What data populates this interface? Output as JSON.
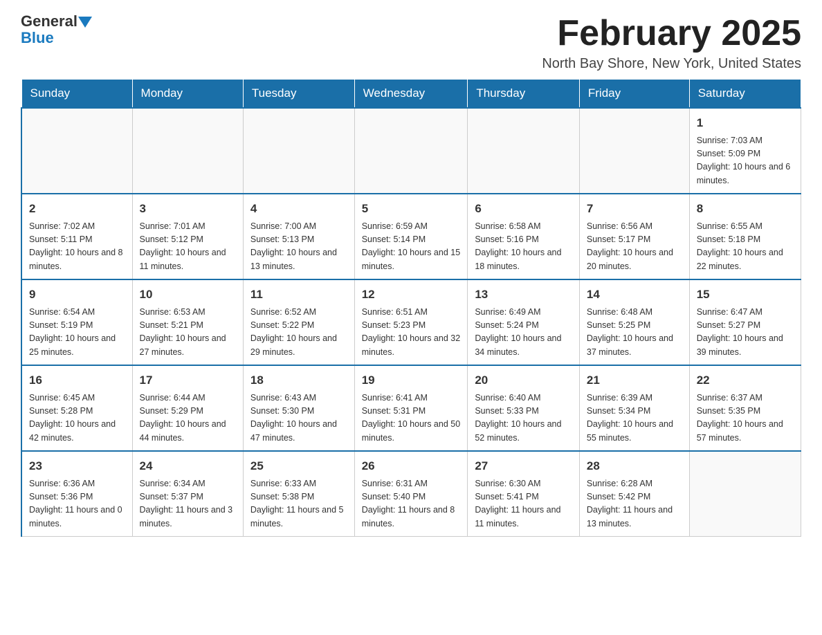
{
  "logo": {
    "general": "General",
    "blue": "Blue"
  },
  "header": {
    "title": "February 2025",
    "location": "North Bay Shore, New York, United States"
  },
  "days_of_week": [
    "Sunday",
    "Monday",
    "Tuesday",
    "Wednesday",
    "Thursday",
    "Friday",
    "Saturday"
  ],
  "weeks": [
    [
      {
        "day": "",
        "info": ""
      },
      {
        "day": "",
        "info": ""
      },
      {
        "day": "",
        "info": ""
      },
      {
        "day": "",
        "info": ""
      },
      {
        "day": "",
        "info": ""
      },
      {
        "day": "",
        "info": ""
      },
      {
        "day": "1",
        "info": "Sunrise: 7:03 AM\nSunset: 5:09 PM\nDaylight: 10 hours and 6 minutes."
      }
    ],
    [
      {
        "day": "2",
        "info": "Sunrise: 7:02 AM\nSunset: 5:11 PM\nDaylight: 10 hours and 8 minutes."
      },
      {
        "day": "3",
        "info": "Sunrise: 7:01 AM\nSunset: 5:12 PM\nDaylight: 10 hours and 11 minutes."
      },
      {
        "day": "4",
        "info": "Sunrise: 7:00 AM\nSunset: 5:13 PM\nDaylight: 10 hours and 13 minutes."
      },
      {
        "day": "5",
        "info": "Sunrise: 6:59 AM\nSunset: 5:14 PM\nDaylight: 10 hours and 15 minutes."
      },
      {
        "day": "6",
        "info": "Sunrise: 6:58 AM\nSunset: 5:16 PM\nDaylight: 10 hours and 18 minutes."
      },
      {
        "day": "7",
        "info": "Sunrise: 6:56 AM\nSunset: 5:17 PM\nDaylight: 10 hours and 20 minutes."
      },
      {
        "day": "8",
        "info": "Sunrise: 6:55 AM\nSunset: 5:18 PM\nDaylight: 10 hours and 22 minutes."
      }
    ],
    [
      {
        "day": "9",
        "info": "Sunrise: 6:54 AM\nSunset: 5:19 PM\nDaylight: 10 hours and 25 minutes."
      },
      {
        "day": "10",
        "info": "Sunrise: 6:53 AM\nSunset: 5:21 PM\nDaylight: 10 hours and 27 minutes."
      },
      {
        "day": "11",
        "info": "Sunrise: 6:52 AM\nSunset: 5:22 PM\nDaylight: 10 hours and 29 minutes."
      },
      {
        "day": "12",
        "info": "Sunrise: 6:51 AM\nSunset: 5:23 PM\nDaylight: 10 hours and 32 minutes."
      },
      {
        "day": "13",
        "info": "Sunrise: 6:49 AM\nSunset: 5:24 PM\nDaylight: 10 hours and 34 minutes."
      },
      {
        "day": "14",
        "info": "Sunrise: 6:48 AM\nSunset: 5:25 PM\nDaylight: 10 hours and 37 minutes."
      },
      {
        "day": "15",
        "info": "Sunrise: 6:47 AM\nSunset: 5:27 PM\nDaylight: 10 hours and 39 minutes."
      }
    ],
    [
      {
        "day": "16",
        "info": "Sunrise: 6:45 AM\nSunset: 5:28 PM\nDaylight: 10 hours and 42 minutes."
      },
      {
        "day": "17",
        "info": "Sunrise: 6:44 AM\nSunset: 5:29 PM\nDaylight: 10 hours and 44 minutes."
      },
      {
        "day": "18",
        "info": "Sunrise: 6:43 AM\nSunset: 5:30 PM\nDaylight: 10 hours and 47 minutes."
      },
      {
        "day": "19",
        "info": "Sunrise: 6:41 AM\nSunset: 5:31 PM\nDaylight: 10 hours and 50 minutes."
      },
      {
        "day": "20",
        "info": "Sunrise: 6:40 AM\nSunset: 5:33 PM\nDaylight: 10 hours and 52 minutes."
      },
      {
        "day": "21",
        "info": "Sunrise: 6:39 AM\nSunset: 5:34 PM\nDaylight: 10 hours and 55 minutes."
      },
      {
        "day": "22",
        "info": "Sunrise: 6:37 AM\nSunset: 5:35 PM\nDaylight: 10 hours and 57 minutes."
      }
    ],
    [
      {
        "day": "23",
        "info": "Sunrise: 6:36 AM\nSunset: 5:36 PM\nDaylight: 11 hours and 0 minutes."
      },
      {
        "day": "24",
        "info": "Sunrise: 6:34 AM\nSunset: 5:37 PM\nDaylight: 11 hours and 3 minutes."
      },
      {
        "day": "25",
        "info": "Sunrise: 6:33 AM\nSunset: 5:38 PM\nDaylight: 11 hours and 5 minutes."
      },
      {
        "day": "26",
        "info": "Sunrise: 6:31 AM\nSunset: 5:40 PM\nDaylight: 11 hours and 8 minutes."
      },
      {
        "day": "27",
        "info": "Sunrise: 6:30 AM\nSunset: 5:41 PM\nDaylight: 11 hours and 11 minutes."
      },
      {
        "day": "28",
        "info": "Sunrise: 6:28 AM\nSunset: 5:42 PM\nDaylight: 11 hours and 13 minutes."
      },
      {
        "day": "",
        "info": ""
      }
    ]
  ]
}
